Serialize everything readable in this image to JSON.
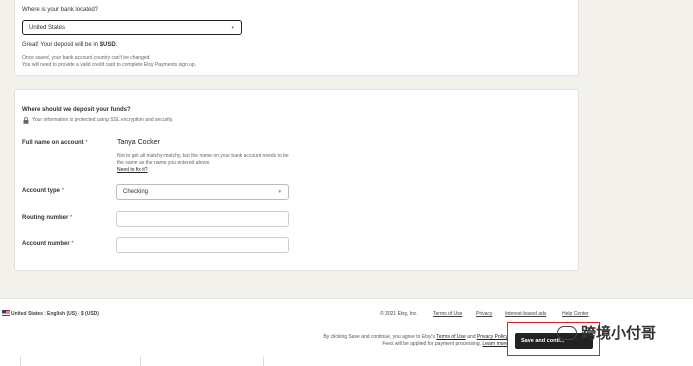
{
  "bank": {
    "question": "Where is your bank located?",
    "country_value": "United States",
    "deposit_prefix": "Great! Your deposit will be in ",
    "deposit_currency": "$USD",
    "deposit_suffix": ".",
    "note_line1": "Once saved, your bank account country can't be changed.",
    "note_line2": "You will need to provide a valid credit card to complete Etsy Payments sign up."
  },
  "deposit": {
    "heading": "Where should we deposit your funds?",
    "security_note": "Your information is protected using SSL encryption and security.",
    "full_name_label": "Full name on account",
    "full_name_value": "Tanya Cocker",
    "name_hint": "Not to get all matchy-matchy, but the name on your bank account needs to be the same as the name you entered above.",
    "fix_link": "Need to fix it?",
    "account_type_label": "Account type",
    "account_type_value": "Checking",
    "routing_label": "Routing number",
    "routing_value": "",
    "account_number_label": "Account number",
    "account_number_value": "",
    "required_mark": "*"
  },
  "footer": {
    "region": "United States",
    "language": "English (US)",
    "currency": "$ (USD)",
    "separator": "|",
    "copyright": "© 2021 Etsy, Inc.",
    "links": [
      "Terms of Use",
      "Privacy",
      "Interest-based ads",
      "Help Center"
    ]
  },
  "submit": {
    "consent_prefix": "By clicking Save and continue, you agree to Etsy's ",
    "terms_link": "Terms of Use",
    "consent_and": " and ",
    "privacy_link": "Privacy Policy",
    "fees_note": "Fees will be applied for payment processing.",
    "learn_more": "Learn more",
    "button_label": "Save and conti..."
  },
  "watermark": {
    "text": "跨境小付哥"
  },
  "colors": {
    "background": "#f3f1ec",
    "button": "#222222",
    "highlight_box": "#e02020",
    "required": "#cc3333"
  }
}
